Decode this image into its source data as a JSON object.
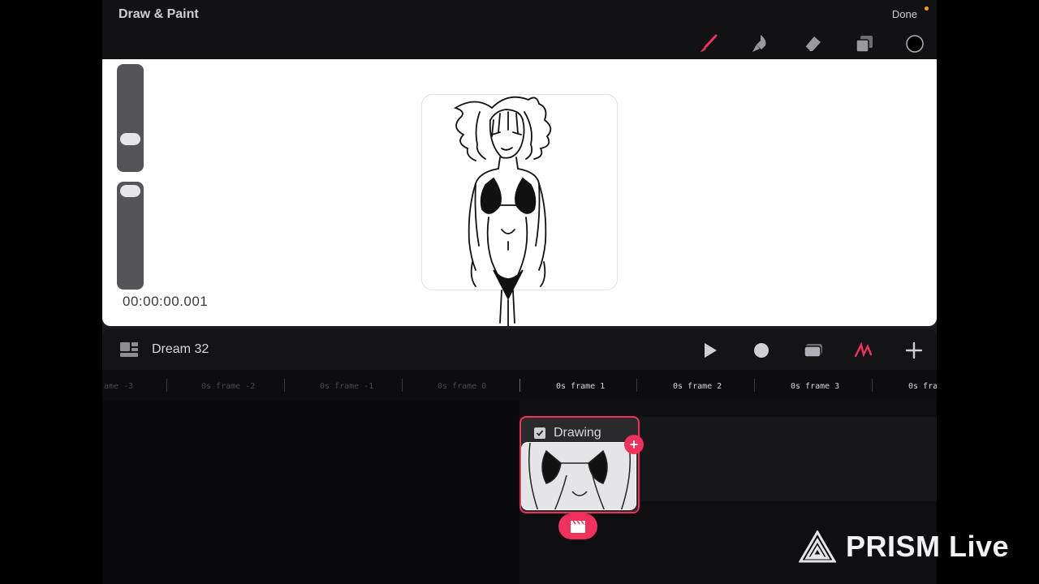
{
  "topbar": {
    "title": "Draw & Paint",
    "done_label": "Done",
    "tools": [
      "brush-icon",
      "smudge-icon",
      "eraser-icon",
      "layers-icon",
      "color-swatch-icon"
    ],
    "accent": "#f0315c"
  },
  "canvas": {
    "timecode": "00:00:00.001"
  },
  "timeline": {
    "project_name": "Dream 32",
    "toolbar": [
      "grid-icon",
      "play-icon",
      "record-icon",
      "layers-icon",
      "draw-icon",
      "plus-icon"
    ],
    "frames": [
      "ame -3",
      "0s frame -2",
      "0s frame -1",
      "0s frame 0",
      "0s frame 1",
      "0s frame 2",
      "0s frame 3",
      "0s fram"
    ],
    "layer": {
      "label": "Drawing",
      "checked": true
    }
  },
  "watermark": {
    "text": "PRISM Live"
  }
}
